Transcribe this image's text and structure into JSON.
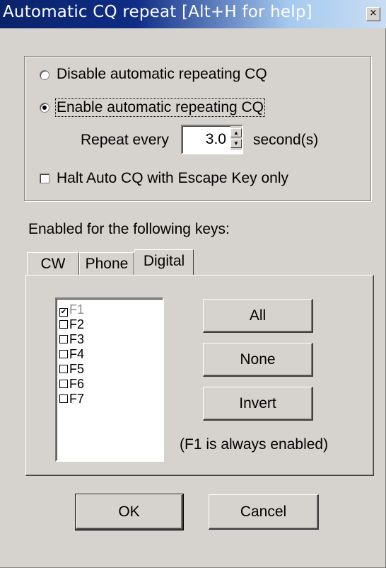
{
  "window": {
    "title": "Automatic CQ repeat [Alt+H for help]",
    "close_glyph": "×"
  },
  "cq_group": {
    "disable_label": "Disable automatic repeating CQ",
    "enable_label": "Enable automatic repeating CQ",
    "selected": "enable",
    "repeat_label": "Repeat every",
    "repeat_value": "3.0",
    "unit_label": "second(s)",
    "halt_label": "Halt Auto CQ with Escape Key only",
    "halt_checked": false
  },
  "keys_section": {
    "heading": "Enabled for the following keys:",
    "tabs": [
      {
        "label": "CW",
        "active": false
      },
      {
        "label": "Phone",
        "active": false
      },
      {
        "label": "Digital",
        "active": true
      }
    ],
    "keys": [
      {
        "label": "F1",
        "checked": true,
        "disabled": true
      },
      {
        "label": "F2",
        "checked": false,
        "disabled": false
      },
      {
        "label": "F3",
        "checked": false,
        "disabled": false
      },
      {
        "label": "F4",
        "checked": false,
        "disabled": false
      },
      {
        "label": "F5",
        "checked": false,
        "disabled": false
      },
      {
        "label": "F6",
        "checked": false,
        "disabled": false
      },
      {
        "label": "F7",
        "checked": false,
        "disabled": false
      }
    ],
    "all_label": "All",
    "none_label": "None",
    "invert_label": "Invert",
    "note": "(F1 is always enabled)"
  },
  "footer": {
    "ok_label": "OK",
    "cancel_label": "Cancel"
  },
  "icons": {
    "radio_selected": "radio-dot",
    "checkbox_checked": "✔",
    "spin_up": "▲",
    "spin_down": "▼"
  }
}
